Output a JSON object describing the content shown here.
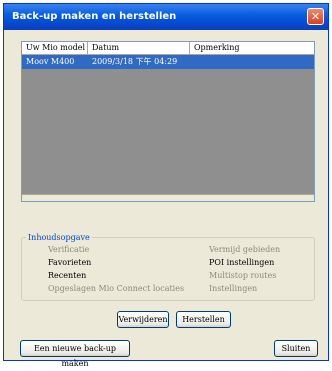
{
  "window": {
    "title": "Back-up maken en herstellen",
    "close_glyph": "✕"
  },
  "list": {
    "columns": [
      "Uw Mio model",
      "Datum",
      "Opmerking"
    ],
    "rows": [
      {
        "model": "Moov M400",
        "date": "2009/3/18 下午 04:29",
        "note": "",
        "selected": true
      }
    ]
  },
  "contents": {
    "legend": "Inhoudsopgave",
    "left": [
      {
        "label": "Verificatie",
        "enabled": false
      },
      {
        "label": "Favorieten",
        "enabled": true
      },
      {
        "label": "Recenten",
        "enabled": true
      },
      {
        "label": "Opgeslagen Mio Connect locaties",
        "enabled": false
      }
    ],
    "right": [
      {
        "label": "Vermijd gebieden",
        "enabled": false
      },
      {
        "label": "POI instellingen",
        "enabled": true
      },
      {
        "label": "Multistop routes",
        "enabled": false
      },
      {
        "label": "Instellingen",
        "enabled": false
      }
    ]
  },
  "buttons": {
    "delete": "Verwijderen",
    "restore": "Herstellen",
    "new_backup": "Een nieuwe back-up maken",
    "close": "Sluiten"
  },
  "colors": {
    "selection": "#316ac5",
    "list_background": "#8f8f8f",
    "legend": "#0046d5"
  }
}
